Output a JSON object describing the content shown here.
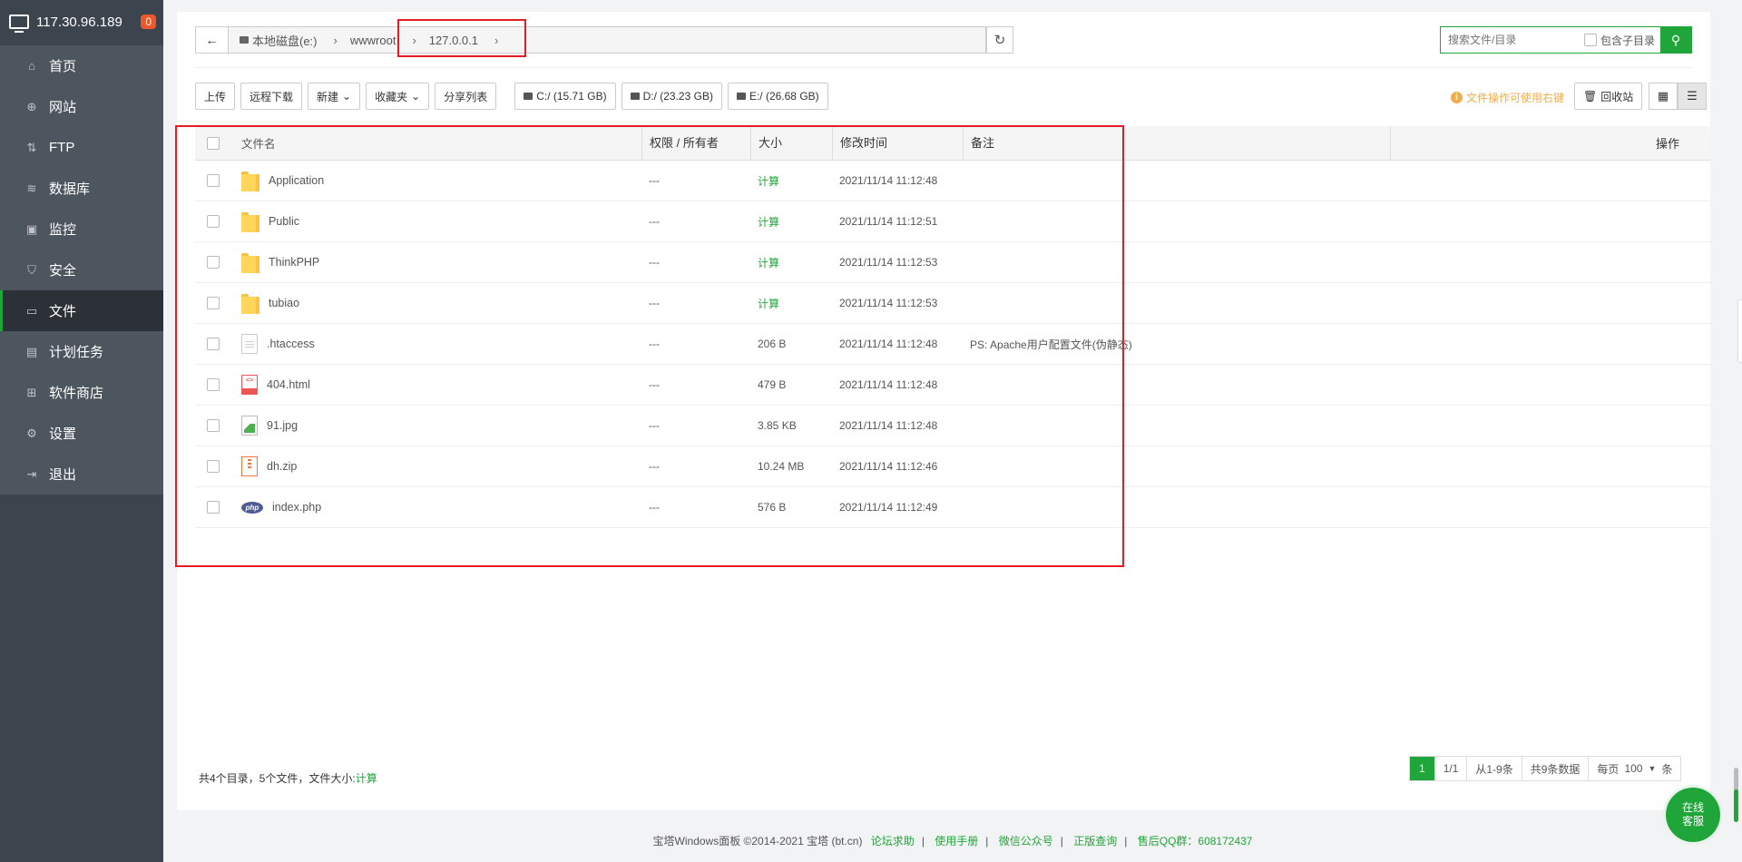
{
  "sidebar": {
    "ip": "117.30.96.189",
    "badge": "0",
    "items": [
      {
        "label": "首页",
        "icon": "home-icon"
      },
      {
        "label": "网站",
        "icon": "globe-icon"
      },
      {
        "label": "FTP",
        "icon": "ftp-icon"
      },
      {
        "label": "数据库",
        "icon": "database-icon"
      },
      {
        "label": "监控",
        "icon": "monitor-icon"
      },
      {
        "label": "安全",
        "icon": "shield-icon"
      },
      {
        "label": "文件",
        "icon": "folder-icon",
        "active": true
      },
      {
        "label": "计划任务",
        "icon": "calendar-icon"
      },
      {
        "label": "软件商店",
        "icon": "grid-icon"
      },
      {
        "label": "设置",
        "icon": "gear-icon"
      },
      {
        "label": "退出",
        "icon": "logout-icon"
      }
    ]
  },
  "path": {
    "crumbs": [
      "本地磁盘(e:)",
      "wwwroot",
      "127.0.0.1"
    ]
  },
  "search": {
    "placeholder": "搜索文件/目录",
    "include_sub": "包含子目录"
  },
  "toolbar": {
    "upload": "上传",
    "remote_download": "远程下载",
    "new": "新建",
    "favorites": "收藏夹",
    "share_list": "分享列表",
    "disk_c": "C:/ (15.71 GB)",
    "disk_d": "D:/ (23.23 GB)",
    "disk_e": "E:/ (26.68 GB)",
    "tip": "文件操作可使用右键",
    "recycle": "回收站"
  },
  "table": {
    "headers": {
      "name": "文件名",
      "perm": "权限 / 所有者",
      "size": "大小",
      "mtime": "修改时间",
      "note": "备注",
      "op": "操作"
    },
    "rows": [
      {
        "name": "Application",
        "type": "folder",
        "perm": "---",
        "size": "计算",
        "mtime": "2021/11/14 11:12:48",
        "note": ""
      },
      {
        "name": "Public",
        "type": "folder",
        "perm": "---",
        "size": "计算",
        "mtime": "2021/11/14 11:12:51",
        "note": ""
      },
      {
        "name": "ThinkPHP",
        "type": "folder",
        "perm": "---",
        "size": "计算",
        "mtime": "2021/11/14 11:12:53",
        "note": ""
      },
      {
        "name": "tubiao",
        "type": "folder",
        "perm": "---",
        "size": "计算",
        "mtime": "2021/11/14 11:12:53",
        "note": ""
      },
      {
        "name": ".htaccess",
        "type": "file",
        "perm": "---",
        "size": "206 B",
        "mtime": "2021/11/14 11:12:48",
        "note": "PS: Apache用户配置文件(伪静态)"
      },
      {
        "name": "404.html",
        "type": "html",
        "perm": "---",
        "size": "479 B",
        "mtime": "2021/11/14 11:12:48",
        "note": ""
      },
      {
        "name": "91.jpg",
        "type": "image",
        "perm": "---",
        "size": "3.85 KB",
        "mtime": "2021/11/14 11:12:48",
        "note": ""
      },
      {
        "name": "dh.zip",
        "type": "zip",
        "perm": "---",
        "size": "10.24 MB",
        "mtime": "2021/11/14 11:12:46",
        "note": ""
      },
      {
        "name": "index.php",
        "type": "php",
        "perm": "---",
        "size": "576 B",
        "mtime": "2021/11/14 11:12:49",
        "note": ""
      }
    ]
  },
  "summary": {
    "text": "共4个目录，5个文件，文件大小:",
    "calc": "计算"
  },
  "pager": {
    "current": "1",
    "pages": "1/1",
    "range": "从1-9条",
    "total": "共9条数据",
    "per_page_label": "每页",
    "per_page": "100",
    "unit": "条"
  },
  "footer": {
    "copyright": "宝塔Windows面板 ©2014-2021 宝塔 (bt.cn)",
    "links": [
      "论坛求助",
      "使用手册",
      "微信公众号",
      "正版查询",
      "售后QQ群：608172437"
    ]
  },
  "chat": {
    "line1": "在线",
    "line2": "客服"
  },
  "colors": {
    "accent": "#20a53a",
    "sidebar": "#3c444d",
    "highlight_box": "#e51c23",
    "tip": "#f0ad4e"
  }
}
